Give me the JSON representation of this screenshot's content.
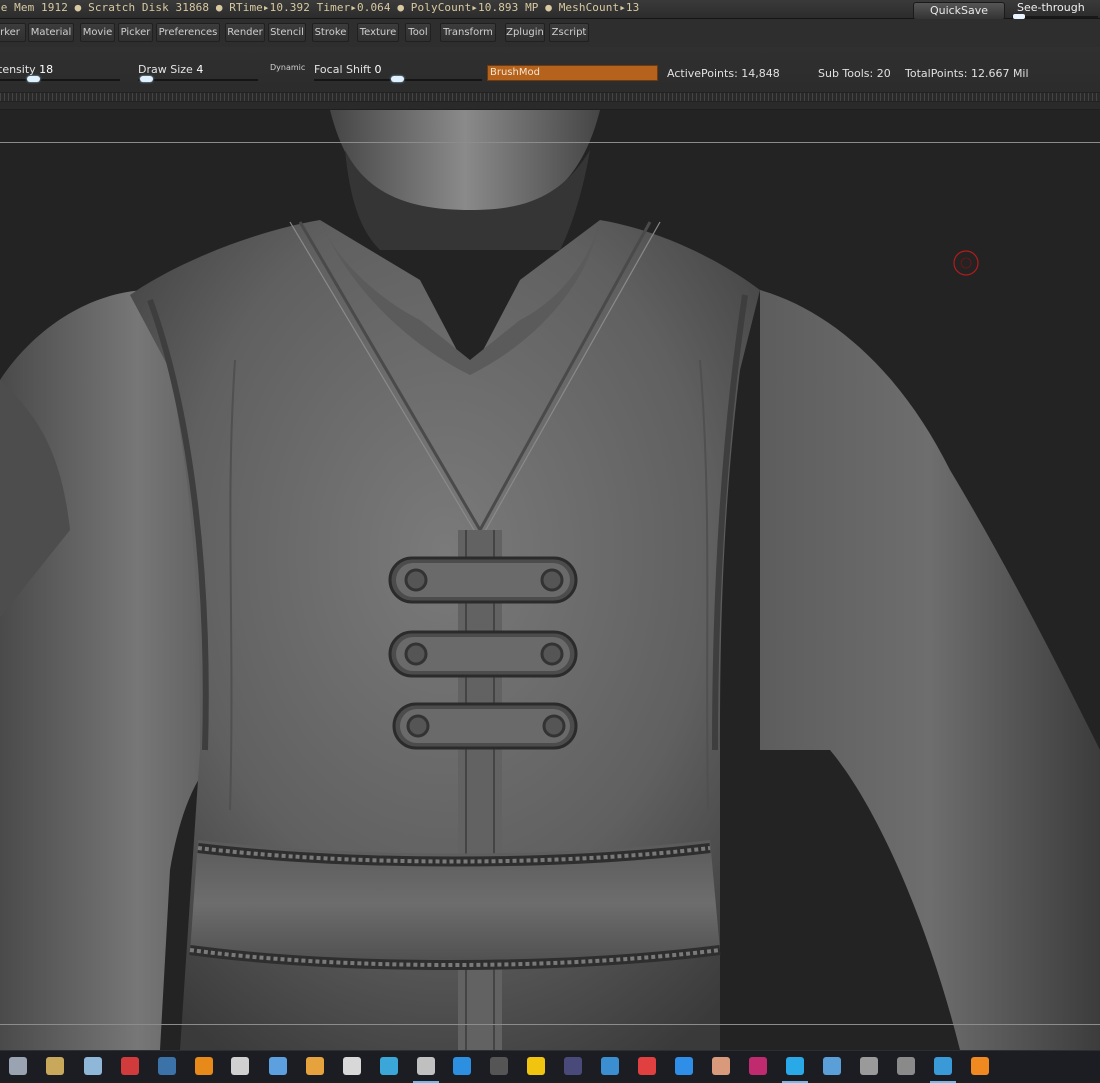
{
  "status_bar": {
    "text": "ve Mem 1912 ● Scratch Disk 31868 ● RTime▸10.392 Timer▸0.064 ● PolyCount▸10.893 MP ● MeshCount▸13",
    "quicksave_label": "QuickSave",
    "seethrough_label": "See-through",
    "seethrough_value": 0
  },
  "menu": {
    "items": [
      "rker",
      "Material",
      "Movie",
      "Picker",
      "Preferences",
      "Render",
      "Stencil",
      "Stroke",
      "Texture",
      "Tool",
      "Transform",
      "Zplugin",
      "Zscript"
    ]
  },
  "toolbar": {
    "intensity_label": "tensity",
    "intensity_value": "18",
    "draw_size_label": "Draw Size",
    "draw_size_value": "4",
    "dynamic_label": "Dynamic",
    "focal_shift_label": "Focal Shift",
    "focal_shift_value": "0",
    "brushmod_label": "BrushMod",
    "active_points_label": "ActivePoints:",
    "active_points_value": "14,848",
    "sub_tools_label": "Sub Tools:",
    "sub_tools_value": "20",
    "total_points_label": "TotalPoints:",
    "total_points_value": "12.667 Mil"
  },
  "viewport": {
    "model": "sculpted-vest-figure",
    "material_color": "#6e6e6e",
    "background_color": "#232323"
  },
  "taskbar": {
    "icons": [
      {
        "name": "settings-app-icon",
        "color": "#9aa3b2"
      },
      {
        "name": "file-explorer-icon",
        "color": "#c8a85a"
      },
      {
        "name": "recycle-icon",
        "color": "#8fb7d8"
      },
      {
        "name": "app-red-icon",
        "color": "#d23b3b"
      },
      {
        "name": "steam-icon",
        "color": "#3b73a8"
      },
      {
        "name": "app-orange-icon",
        "color": "#e88a1a"
      },
      {
        "name": "microphone-icon",
        "color": "#d0d0d0"
      },
      {
        "name": "globe-app-icon",
        "color": "#5ca0e0"
      },
      {
        "name": "media-app-icon",
        "color": "#e6a23c"
      },
      {
        "name": "unity-icon",
        "color": "#d8d8d8"
      },
      {
        "name": "kodi-app-icon",
        "color": "#3aa7d8"
      },
      {
        "name": "blender-like-icon",
        "color": "#c0c0c0"
      },
      {
        "name": "visual-studio-code-icon",
        "color": "#2d8fe0"
      },
      {
        "name": "k-app-icon",
        "color": "#555555"
      },
      {
        "name": "m-app-icon",
        "color": "#f1c40f"
      },
      {
        "name": "after-effects-icon",
        "color": "#4a4a7a"
      },
      {
        "name": "flask-app-icon",
        "color": "#3b8fd0"
      },
      {
        "name": "app-red2-icon",
        "color": "#e04040"
      },
      {
        "name": "chrome-like-icon",
        "color": "#2f8fe8"
      },
      {
        "name": "photo-app-icon",
        "color": "#d89a7a"
      },
      {
        "name": "indesign-icon",
        "color": "#c02a6e"
      },
      {
        "name": "skype-icon",
        "color": "#2aa9e8"
      },
      {
        "name": "shield-app-icon",
        "color": "#5a9fd8"
      },
      {
        "name": "gauge-app-icon",
        "color": "#9a9a9a"
      },
      {
        "name": "axis-app-icon",
        "color": "#8a8a8a"
      },
      {
        "name": "browser-icon",
        "color": "#3a9ad8"
      },
      {
        "name": "zbrush-icon",
        "color": "#f08a20"
      }
    ],
    "icon_x": [
      18,
      55,
      93,
      130,
      167,
      204,
      240,
      278,
      315,
      352,
      389,
      426,
      462,
      499,
      536,
      573,
      610,
      647,
      684,
      721,
      758,
      795,
      832,
      869,
      906,
      943,
      980
    ],
    "active_indices": [
      11,
      21,
      25
    ]
  }
}
